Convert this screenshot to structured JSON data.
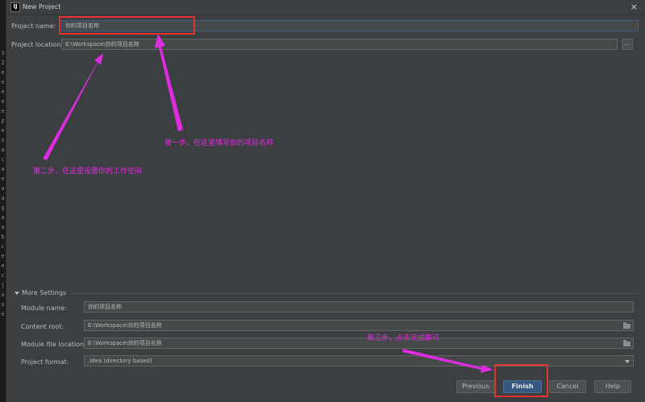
{
  "left_strip_chars": [
    "3",
    "2",
    "e",
    "e",
    "e",
    "e",
    "e",
    "p",
    "e",
    "s",
    "a",
    "c",
    "a",
    "e",
    "a",
    "a",
    "g",
    "a",
    "a",
    "b",
    "c",
    "e",
    "e",
    "c",
    "j",
    "o",
    "o",
    "e"
  ],
  "dialog": {
    "title": "New Project",
    "close_glyph": "×"
  },
  "fields": {
    "project_name_label": "Project name:",
    "project_name_value": "你的项目名称",
    "project_location_label": "Project location:",
    "project_location_value": "E:\\Workspace\\你的项目名称",
    "browse_glyph": "..."
  },
  "more_settings": {
    "title": "More Settings",
    "module_name_label": "Module name:",
    "module_name_value": "你的项目名称",
    "content_root_label": "Content root:",
    "content_root_value": "E:\\Workspace\\你的项目名称",
    "module_file_location_label": "Module file location:",
    "module_file_location_value": "E:\\Workspace\\你的项目名称",
    "project_format_label": "Project format:",
    "project_format_value": ".idea (directory based)"
  },
  "buttons": {
    "previous": "Previous",
    "finish": "Finish",
    "cancel": "Cancel",
    "help": "Help"
  },
  "annotations": {
    "step1": "第一步，在这里填写你的项目名称",
    "step2": "第二步，在这里设置你的工作空间",
    "step3": "第三步，点击完成即可"
  },
  "colors": {
    "annotation": "#e02ce0",
    "highlight_box": "#e3342f",
    "primary_button": "#365880"
  }
}
